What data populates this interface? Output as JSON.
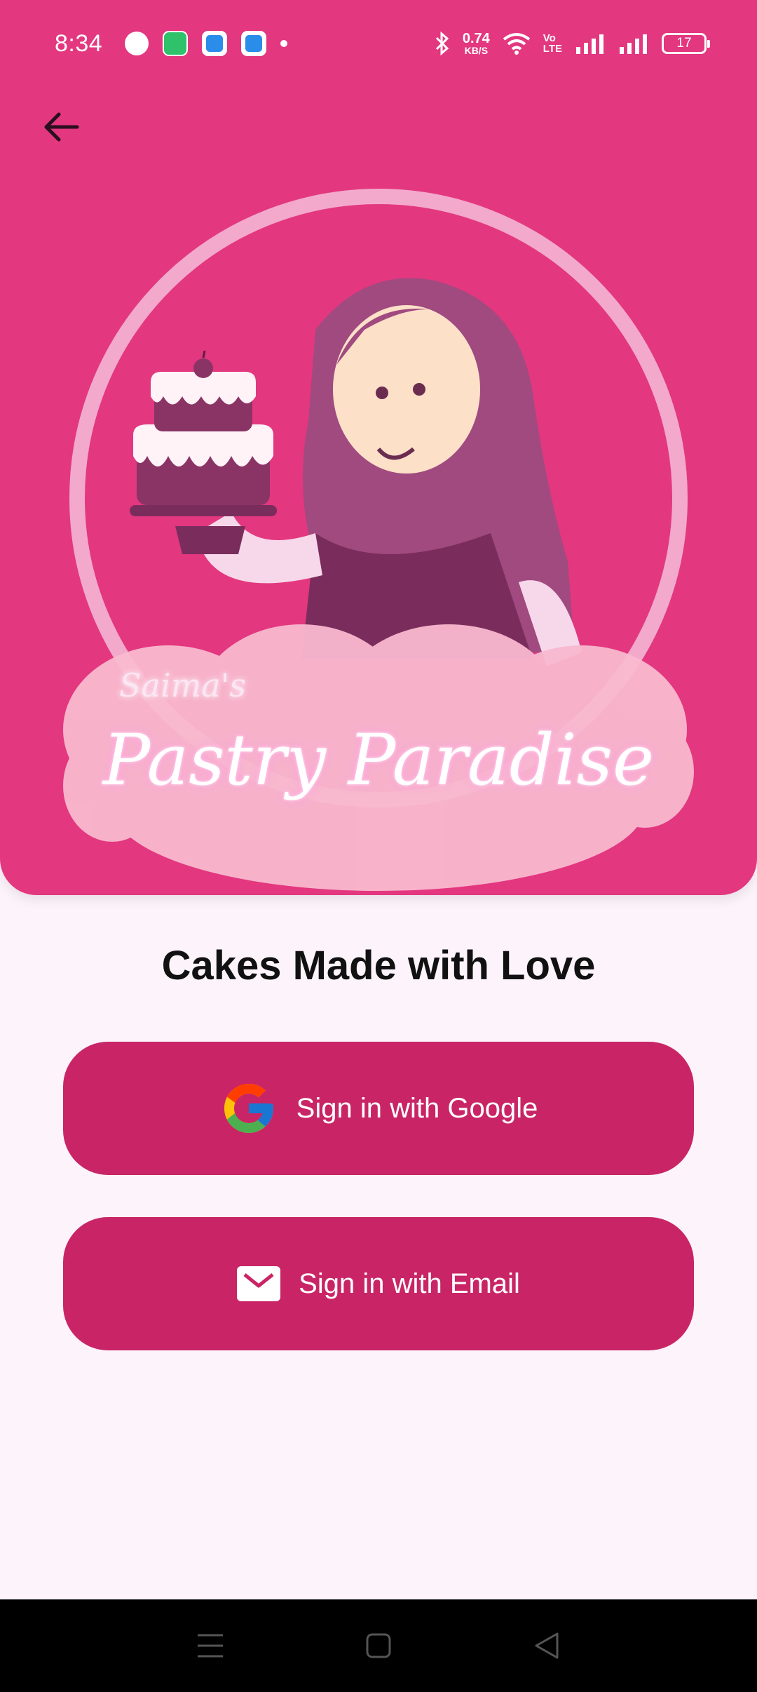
{
  "status_bar": {
    "time": "8:34",
    "network_speed": "0.74",
    "network_unit": "KB/S",
    "volte_top": "Vo",
    "volte_bottom": "LTE",
    "battery": "17"
  },
  "hero": {
    "logo_small": "Saima's",
    "logo_big": "Pastry Paradise"
  },
  "tagline": "Cakes Made with Love",
  "buttons": {
    "google": "Sign in with Google",
    "email": "Sign in with Email"
  },
  "icons": [
    "back-arrow-icon",
    "google-icon",
    "email-icon",
    "menu-icon",
    "home-icon",
    "back-icon"
  ],
  "colors": {
    "hero_bg": "#e3377f",
    "button_bg": "#c92566",
    "page_bg": "#fdf4fb"
  }
}
